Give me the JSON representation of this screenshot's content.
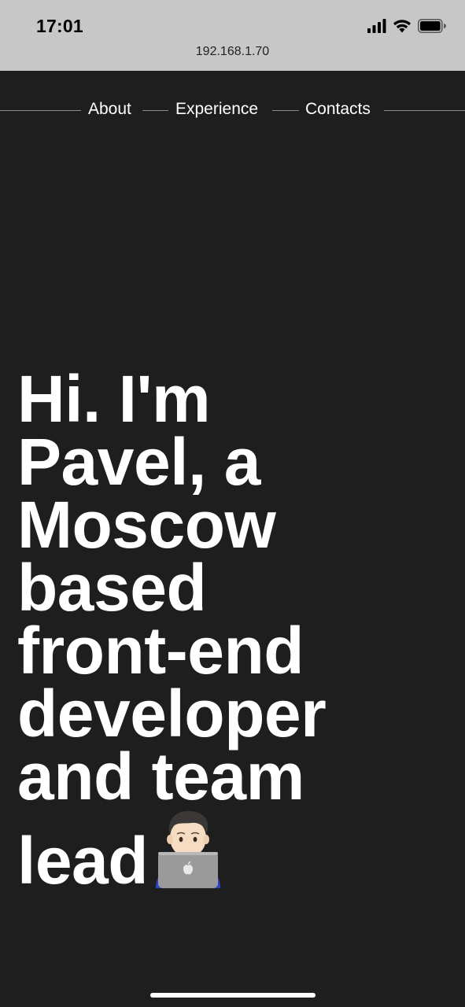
{
  "status_bar": {
    "time": "17:01",
    "icons": [
      "cellular-signal-icon",
      "wifi-icon",
      "battery-icon"
    ]
  },
  "browser": {
    "url": "192.168.1.70"
  },
  "nav": {
    "items": [
      {
        "label": "About"
      },
      {
        "label": "Experience"
      },
      {
        "label": "Contacts"
      }
    ]
  },
  "hero": {
    "lines": [
      "Hi. I'm",
      "Pavel, a",
      "Moscow",
      "based",
      "front-end",
      "developer",
      "and team",
      "lead"
    ],
    "emoji": "technologist-on-laptop-icon"
  },
  "colors": {
    "background": "#1e1e1e",
    "status_bar": "#c7c7c7",
    "text": "#ffffff",
    "nav_line": "#8a8a8a"
  }
}
